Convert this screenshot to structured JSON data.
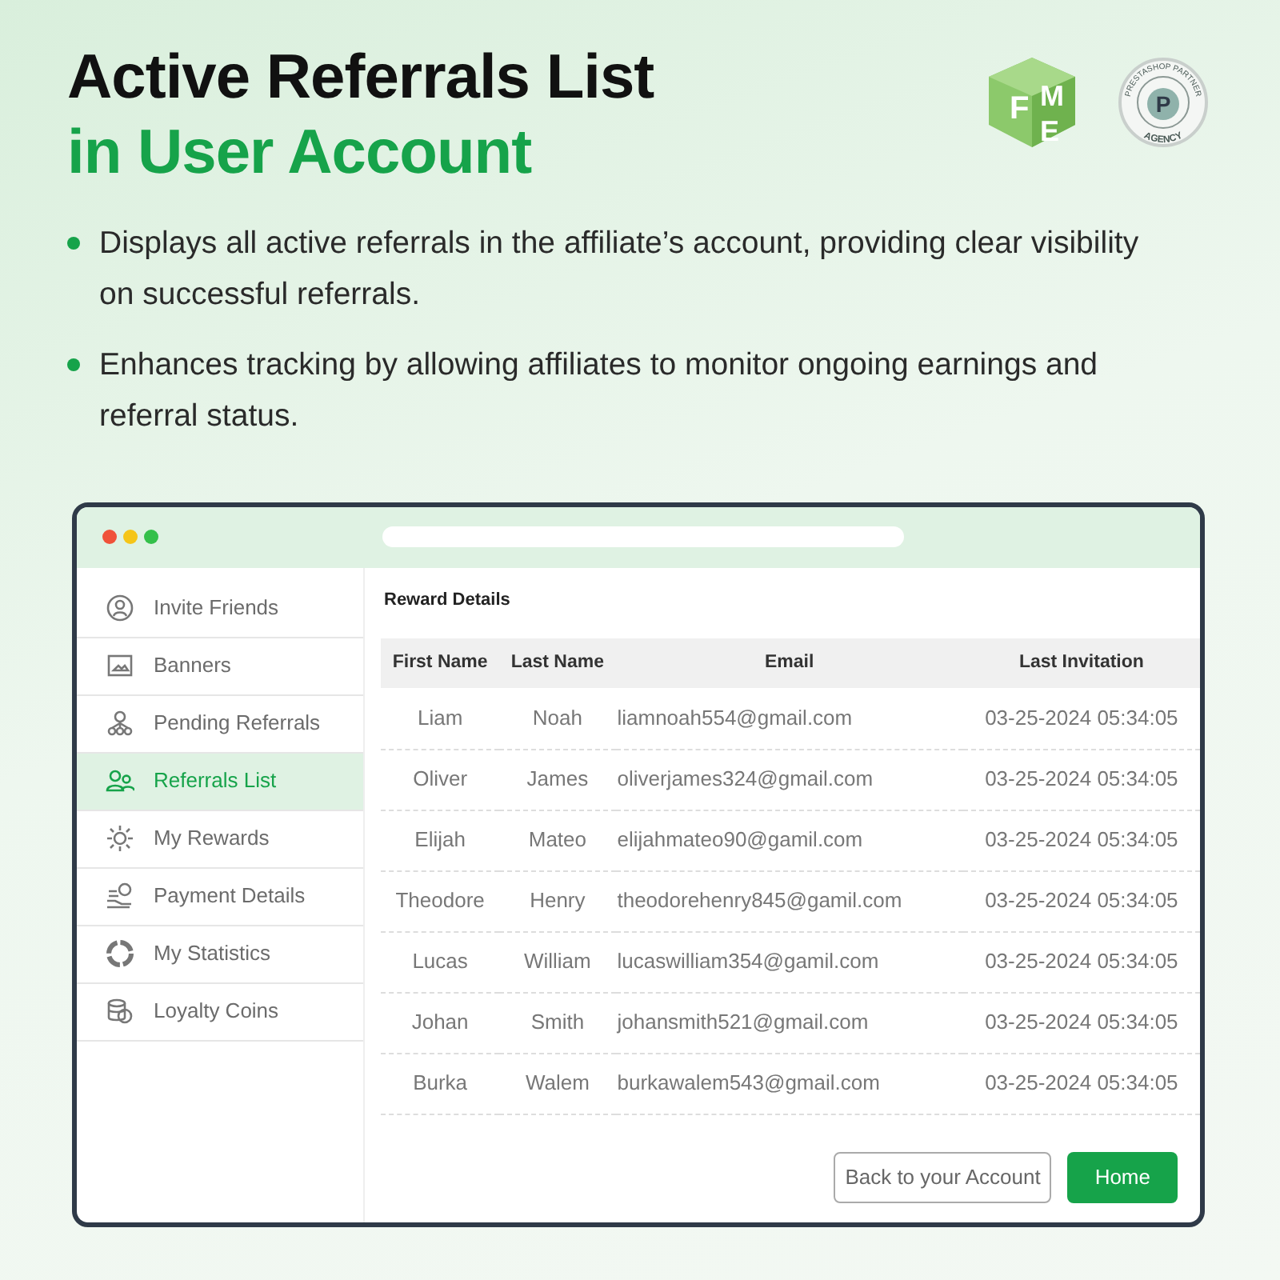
{
  "heading": {
    "line_1": "Active Referrals List",
    "line_2": "in User Account"
  },
  "logos": {
    "fme_letters": [
      "F",
      "M",
      "E"
    ],
    "partner_top": "PRESTASHOP PARTNER",
    "partner_mark": "P",
    "partner_bottom": "AGENCY"
  },
  "bullets": [
    "Displays all active referrals in the affiliate’s account, providing clear visibility on successful referrals.",
    "Enhances tracking by allowing affiliates to monitor ongoing earnings and referral status."
  ],
  "window": {
    "sidebar": {
      "items": [
        {
          "label": "Invite Friends",
          "selected": false
        },
        {
          "label": "Banners",
          "selected": false
        },
        {
          "label": "Pending Referrals",
          "selected": false
        },
        {
          "label": "Referrals List",
          "selected": true
        },
        {
          "label": "My Rewards",
          "selected": false
        },
        {
          "label": "Payment Details",
          "selected": false
        },
        {
          "label": "My Statistics",
          "selected": false
        },
        {
          "label": "Loyalty Coins",
          "selected": false
        }
      ]
    },
    "section_title": "Reward Details",
    "table": {
      "columns": [
        "First Name",
        "Last Name",
        "Email",
        "Last Invitation"
      ],
      "rows": [
        [
          "Liam",
          "Noah",
          "liamnoah554@gmail.com",
          "03-25-2024 05:34:05"
        ],
        [
          "Oliver",
          "James",
          "oliverjames324@gmail.com",
          "03-25-2024 05:34:05"
        ],
        [
          "Elijah",
          "Mateo",
          "elijahmateo90@gamil.com",
          "03-25-2024 05:34:05"
        ],
        [
          "Theodore",
          "Henry",
          "theodorehenry845@gamil.com",
          "03-25-2024 05:34:05"
        ],
        [
          "Lucas",
          "William",
          "lucaswilliam354@gamil.com",
          "03-25-2024 05:34:05"
        ],
        [
          "Johan",
          "Smith",
          "johansmith521@gmail.com",
          "03-25-2024 05:34:05"
        ],
        [
          "Burka",
          "Walem",
          "burkawalem543@gmail.com",
          "03-25-2024 05:34:05"
        ]
      ]
    },
    "buttons": [
      {
        "label": "Back to your Account",
        "kind": "outline"
      },
      {
        "label": "Home",
        "kind": "primary"
      }
    ]
  }
}
